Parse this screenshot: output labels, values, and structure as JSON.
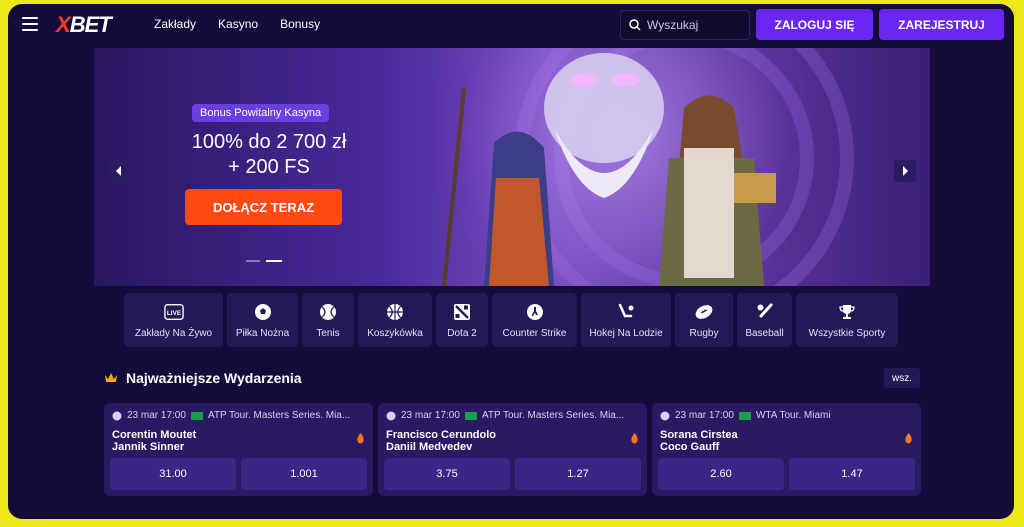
{
  "brand": {
    "logo_text": "XBET"
  },
  "nav": [
    "Zakłady",
    "Kasyno",
    "Bonusy"
  ],
  "search": {
    "placeholder": "Wyszukaj"
  },
  "header_buttons": {
    "login": "ZALOGUJ SIĘ",
    "register": "ZAREJESTRUJ"
  },
  "banner": {
    "pill": "Bonus Powitalny Kasyna",
    "headline_1": "100% do 2 700 zł",
    "headline_2": "+ 200 FS",
    "cta": "DOŁĄCZ TERAZ"
  },
  "sports": [
    {
      "label": "Zakłady Na Żywo",
      "icon": "live-icon"
    },
    {
      "label": "Piłka Nożna",
      "icon": "football-icon"
    },
    {
      "label": "Tenis",
      "icon": "tennis-icon"
    },
    {
      "label": "Koszykówka",
      "icon": "basketball-icon"
    },
    {
      "label": "Dota 2",
      "icon": "dota-icon"
    },
    {
      "label": "Counter Strike",
      "icon": "counter-strike-icon"
    },
    {
      "label": "Hokej Na Lodzie",
      "icon": "hockey-icon"
    },
    {
      "label": "Rugby",
      "icon": "rugby-icon"
    },
    {
      "label": "Baseball",
      "icon": "baseball-icon"
    },
    {
      "label": "Wszystkie Sporty",
      "icon": "trophy-icon"
    }
  ],
  "events_section": {
    "title": "Najważniejsze Wydarzenia",
    "all_label": "wsz."
  },
  "events": [
    {
      "date": "23 mar 17:00",
      "tournament": "ATP Tour. Masters Series. Mia...",
      "team1": "Corentin Moutet",
      "team2": "Jannik Sinner",
      "odd1": "31.00",
      "odd2": "1.001"
    },
    {
      "date": "23 mar 17:00",
      "tournament": "ATP Tour. Masters Series. Mia...",
      "team1": "Francisco Cerundolo",
      "team2": "Daniil Medvedev",
      "odd1": "3.75",
      "odd2": "1.27"
    },
    {
      "date": "23 mar 17:00",
      "tournament": "WTA Tour. Miami",
      "team1": "Sorana Cirstea",
      "team2": "Coco Gauff",
      "odd1": "2.60",
      "odd2": "1.47"
    }
  ],
  "colors": {
    "frame": "#eee71a",
    "background": "#150b3a",
    "accent": "#6a27f2",
    "cta": "#ff4a12"
  }
}
